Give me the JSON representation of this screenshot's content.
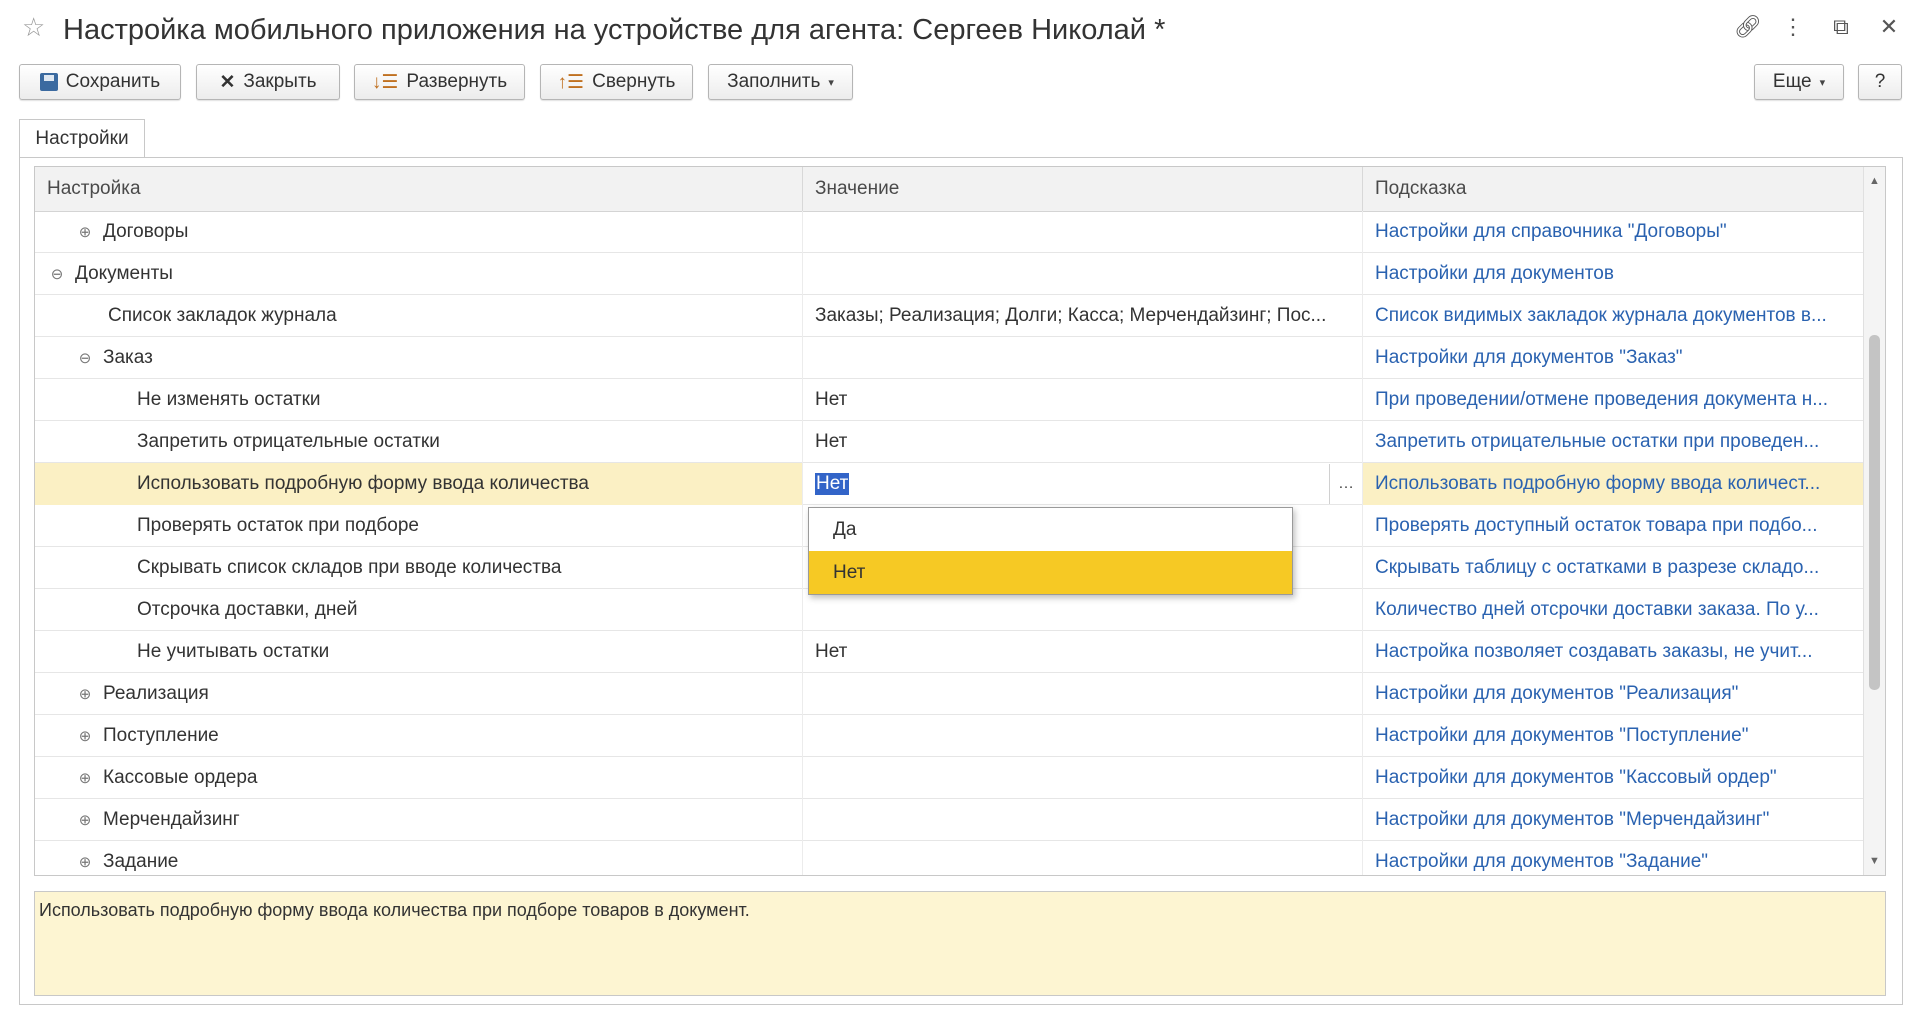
{
  "window": {
    "title": "Настройка мобильного приложения на устройстве для агента: Сергеев Николай *",
    "icons": [
      "star-icon",
      "link-icon",
      "more-icon",
      "restore-icon",
      "close-icon"
    ]
  },
  "toolbar": {
    "save": "Сохранить",
    "close": "Закрыть",
    "expand": "Развернуть",
    "collapse": "Свернуть",
    "fill": "Заполнить",
    "more": "Еще",
    "help": "?"
  },
  "tabs": [
    {
      "label": "Настройки",
      "active": true
    }
  ],
  "grid": {
    "columns": [
      "Настройка",
      "Значение",
      "Подсказка"
    ],
    "rows": [
      {
        "name": "Договоры",
        "toggle": "⊕",
        "value": "",
        "hint": "Настройки для справочника \"Договоры\""
      },
      {
        "name": "Документы",
        "toggle": "⊖",
        "value": "",
        "hint": "Настройки для документов"
      },
      {
        "name": "Список закладок журнала",
        "toggle": "",
        "value": "Заказы; Реализация; Долги; Касса; Мерчендайзинг; Пос...",
        "hint": "Список видимых закладок журнала документов в..."
      },
      {
        "name": "Заказ",
        "toggle": "⊖",
        "value": "",
        "hint": "Настройки для документов \"Заказ\""
      },
      {
        "name": "Не изменять остатки",
        "toggle": "",
        "value": "Нет",
        "hint": "При проведении/отмене проведения документа н..."
      },
      {
        "name": "Запретить отрицательные остатки",
        "toggle": "",
        "value": "Нет",
        "hint": "Запретить отрицательные остатки при проведен..."
      },
      {
        "name": "Использовать подробную форму ввода количества",
        "toggle": "",
        "value": "Нет",
        "hint": "Использовать подробную форму ввода количест..."
      },
      {
        "name": "Проверять остаток при подборе",
        "toggle": "",
        "value": "",
        "hint": "Проверять доступный остаток товара при подбо..."
      },
      {
        "name": "Скрывать список складов при вводе количества",
        "toggle": "",
        "value": "",
        "hint": "Скрывать таблицу с остатками в разрезе складо..."
      },
      {
        "name": "Отсрочка доставки, дней",
        "toggle": "",
        "value": "",
        "hint": "Количество дней отсрочки доставки заказа. По у..."
      },
      {
        "name": "Не учитывать остатки",
        "toggle": "",
        "value": "Нет",
        "hint": "Настройка позволяет создавать заказы, не учит..."
      },
      {
        "name": "Реализация",
        "toggle": "⊕",
        "value": "",
        "hint": "Настройки для документов \"Реализация\""
      },
      {
        "name": "Поступление",
        "toggle": "⊕",
        "value": "",
        "hint": "Настройки для документов \"Поступление\""
      },
      {
        "name": "Кассовые ордера",
        "toggle": "⊕",
        "value": "",
        "hint": "Настройки для документов \"Кассовый ордер\""
      },
      {
        "name": "Мерчендайзинг",
        "toggle": "⊕",
        "value": "",
        "hint": "Настройки для документов \"Мерчендайзинг\""
      },
      {
        "name": "Задание",
        "toggle": "⊕",
        "value": "",
        "hint": "Настройки для документов \"Задание\""
      }
    ],
    "selected_row": 6
  },
  "dropdown": {
    "options": [
      "Да",
      "Нет"
    ],
    "selected": "Нет"
  },
  "hint_text": "Использовать подробную форму ввода количества при подборе товаров в документ.",
  "colors": {
    "link": "#2a62b0",
    "selected_row": "#fbf0c4",
    "dropdown_active": "#f6c924",
    "hint_bg": "#fdf5d2"
  }
}
